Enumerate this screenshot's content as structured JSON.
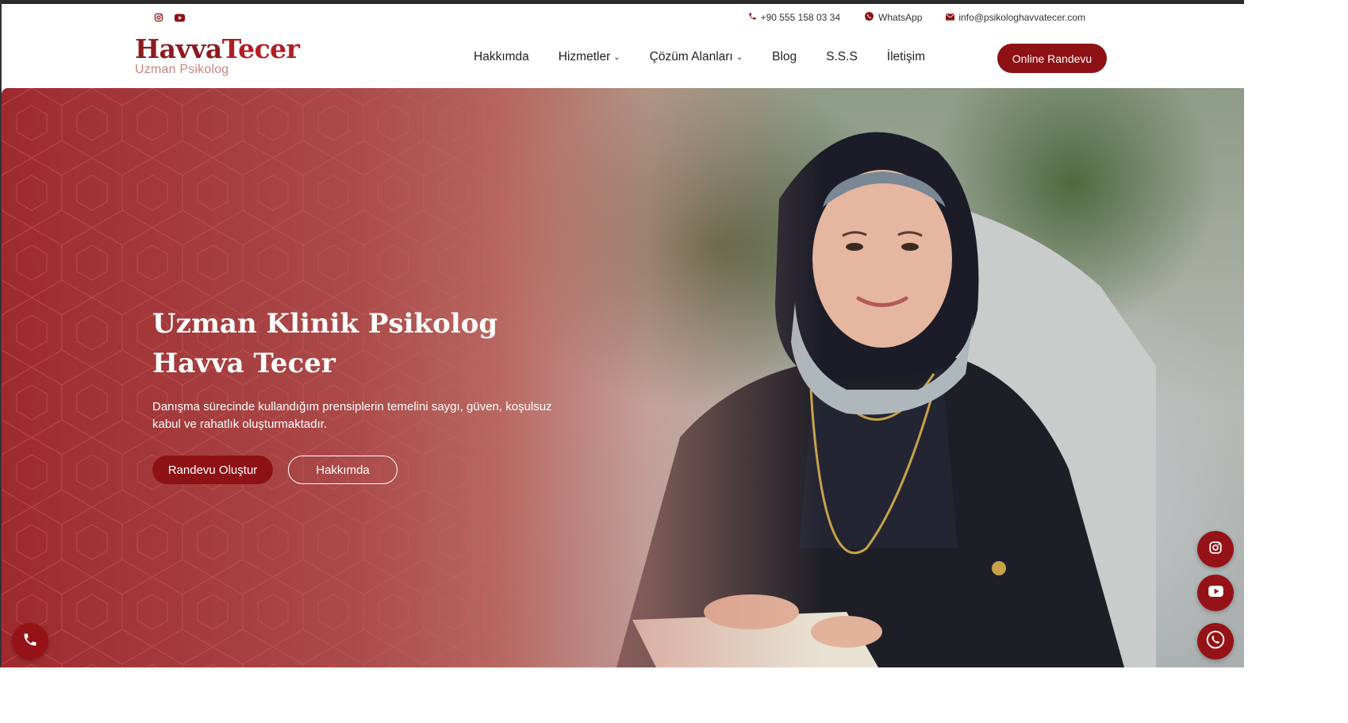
{
  "topbar": {
    "social": [
      {
        "icon": "instagram-icon"
      },
      {
        "icon": "youtube-icon"
      }
    ],
    "phone": "+90 555 158 03 34",
    "whatsapp": "WhatsApp",
    "email": "info@psikologhavvatecer.com"
  },
  "logo": {
    "first": "Havva",
    "last": "Tecer",
    "subtitle": "Uzman Psikolog"
  },
  "nav": {
    "items": [
      {
        "label": "Hakkımda",
        "dropdown": false
      },
      {
        "label": "Hizmetler",
        "dropdown": true
      },
      {
        "label": "Çözüm Alanları",
        "dropdown": true
      },
      {
        "label": "Blog",
        "dropdown": false
      },
      {
        "label": "S.S.S",
        "dropdown": false
      },
      {
        "label": "İletişim",
        "dropdown": false
      }
    ],
    "cta": "Online Randevu"
  },
  "hero": {
    "title_line1": "Uzman Klinik Psikolog",
    "title_line2": "Havva Tecer",
    "description": "Danışma sürecinde kullandığım prensiplerin temelini saygı, güven, koşulsuz kabul ve rahatlık oluşturmaktadır.",
    "primary_button": "Randevu Oluştur",
    "secondary_button": "Hakkımda"
  },
  "floating": {
    "left": [
      "phone-icon"
    ],
    "right": [
      "instagram-icon",
      "youtube-icon",
      "whatsapp-icon"
    ]
  },
  "colors": {
    "brand": "#8e1115",
    "brand_light": "#b01e24",
    "subtitle": "#c9847d",
    "hero_overlay": "#9e2a2e"
  }
}
